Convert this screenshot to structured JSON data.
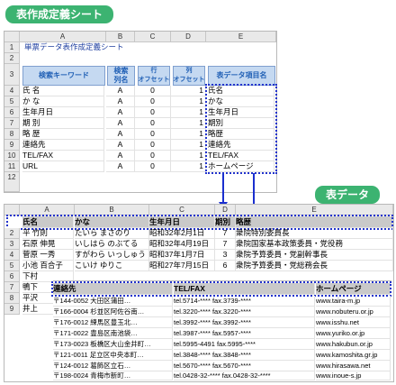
{
  "labels": {
    "badge_top": "表作成定義シート",
    "badge_bottom": "表データ"
  },
  "sheet1": {
    "columns": [
      "A",
      "B",
      "C",
      "D",
      "E"
    ],
    "title": "単票データ表作成定義シート",
    "headers": {
      "search_key": "検索キーワード",
      "search_col": "検索\n列名",
      "row_offset": "行\nオフセット",
      "col_offset": "列\nオフセット",
      "item_name": "表データ項目名"
    },
    "rows": [
      {
        "key": "氏 名",
        "col": "A",
        "ro": "0",
        "co": "1",
        "item": "氏名"
      },
      {
        "key": "か な",
        "col": "A",
        "ro": "0",
        "co": "1",
        "item": "かな"
      },
      {
        "key": "生年月日",
        "col": "A",
        "ro": "0",
        "co": "1",
        "item": "生年月日"
      },
      {
        "key": "期 別",
        "col": "A",
        "ro": "0",
        "co": "1",
        "item": "期別"
      },
      {
        "key": "略 歴",
        "col": "A",
        "ro": "0",
        "co": "1",
        "item": "略歴"
      },
      {
        "key": "連絡先",
        "col": "A",
        "ro": "0",
        "co": "1",
        "item": "連絡先"
      },
      {
        "key": "TEL/FAX",
        "col": "A",
        "ro": "0",
        "co": "1",
        "item": "TEL/FAX"
      },
      {
        "key": "URL",
        "col": "A",
        "ro": "0",
        "co": "1",
        "item": "ホームページ"
      }
    ],
    "row_numbers": [
      "1",
      "2",
      "3",
      "4",
      "5",
      "6",
      "7",
      "8",
      "9",
      "10",
      "11",
      "12"
    ]
  },
  "sheet2": {
    "columns": [
      "A",
      "B",
      "C",
      "D",
      "E"
    ],
    "header_row": [
      "氏名",
      "かな",
      "生年月日",
      "期別",
      "略歴"
    ],
    "rows": [
      {
        "num": "2",
        "a": "平 竹則",
        "b": "たいら まさのり",
        "c": "昭和32年2月1日",
        "d": "7",
        "e": "衆院特別委員長"
      },
      {
        "num": "3",
        "a": "石原 伸晃",
        "b": "いしはら のぶてる",
        "c": "昭和32年4月19日",
        "d": "7",
        "e": "衆院国家基本政策委員・党役務"
      },
      {
        "num": "4",
        "a": "菅原 一秀",
        "b": "すがわら いっしゅう",
        "c": "昭和37年1月7日",
        "d": "3",
        "e": "衆院予算委員・党副幹事長"
      },
      {
        "num": "5",
        "a": "小池 百合子",
        "b": "こいけ ゆりこ",
        "c": "昭和27年7月15日",
        "d": "6",
        "e": "衆院予算委員・党総務会長"
      },
      {
        "num": "6",
        "a": "下村",
        "b": "",
        "c": "",
        "d": "",
        "e": ""
      },
      {
        "num": "7",
        "a": "鴨下",
        "b": "",
        "c": "",
        "d": "",
        "e": ""
      },
      {
        "num": "8",
        "a": "平沢",
        "b": "",
        "c": "",
        "d": "",
        "e": ""
      },
      {
        "num": "9",
        "a": "井上",
        "b": "",
        "c": "",
        "d": "",
        "e": ""
      }
    ],
    "sub_header": [
      "連絡先",
      "TEL/FAX",
      "ホームページ"
    ],
    "sub_rows": [
      {
        "addr": "〒144-0052 大田区蒲田…",
        "tel": "tel.5714-****  fax.3739-****",
        "url": "www.taira-m.jp"
      },
      {
        "addr": "〒166-0004 杉並区阿佐谷南…",
        "tel": "tel.3220-****  fax.3220-****",
        "url": "www.nobuteru.or.jp"
      },
      {
        "addr": "〒176-0012 練馬区豊玉北…",
        "tel": "tel.3992-****  fax.3992-****",
        "url": "www.isshu.net"
      },
      {
        "addr": "〒171-0022 豊島区南池袋…",
        "tel": "tel.3987-****  fax.5957-****",
        "url": "www.yuriko.or.jp"
      },
      {
        "addr": "〒173-0023 板橋区大山金井町…",
        "tel": "tel.5995-4491  fax.5995-****",
        "url": "www.hakubun.or.jp"
      },
      {
        "addr": "〒121-0011 足立区中央本町…",
        "tel": "tel.3848-****  fax.3848-****",
        "url": "www.kamoshita.gr.jp"
      },
      {
        "addr": "〒124-0012 葛飾区立石…",
        "tel": "tel.5670-****  fax.5670-****",
        "url": "www.hirasawa.net"
      },
      {
        "addr": "〒198-0024 青梅市新町…",
        "tel": "tel.0428-32-****  fax.0428-32-****",
        "url": "www.inoue-s.jp"
      }
    ]
  }
}
